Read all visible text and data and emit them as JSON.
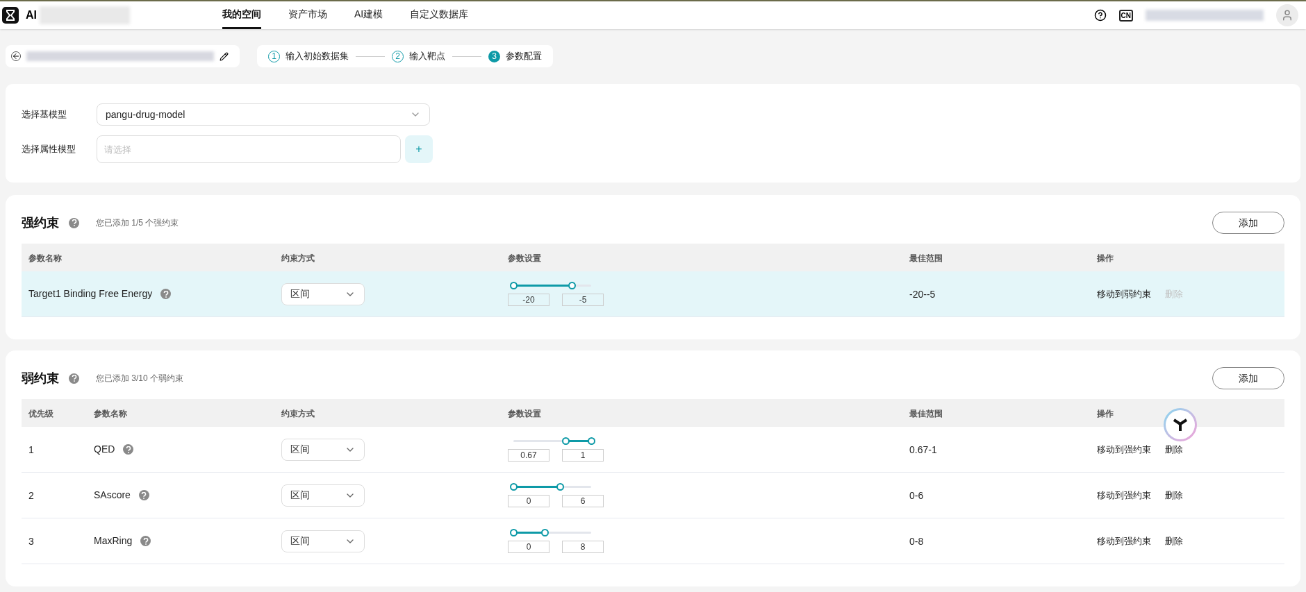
{
  "header": {
    "logo_text": "AI",
    "nav": [
      {
        "label": "我的空间",
        "selected": true
      },
      {
        "label": "资产市场",
        "selected": false
      },
      {
        "label": "AI建模",
        "selected": false
      },
      {
        "label": "自定义数据库",
        "selected": false
      }
    ],
    "lang": "CN"
  },
  "steps": [
    {
      "number": "1",
      "label": "输入初始数据集",
      "selected": false
    },
    {
      "number": "2",
      "label": "输入靶点",
      "selected": false
    },
    {
      "number": "3",
      "label": "参数配置",
      "selected": true
    }
  ],
  "model_form": {
    "base_model": {
      "label": "选择基模型",
      "value": "pangu-drug-model"
    },
    "property_model": {
      "label": "选择属性模型",
      "placeholder": "请选择",
      "add": "+"
    }
  },
  "strong": {
    "title": "强约束",
    "note": "您已添加 1/5 个强约束",
    "add": "添加",
    "columns": [
      "参数名称",
      "约束方式",
      "参数设置",
      "最佳范围",
      "操作"
    ],
    "rows": [
      {
        "name": "Target1 Binding Free Energy",
        "method": "区间",
        "thumbs": [
          {
            "level": 0
          },
          {
            "level": 0.75
          }
        ],
        "low": "-20",
        "high": "-5",
        "range": "-20--5",
        "move": "移动到弱约束",
        "delete": "删除",
        "delete_disabled": true,
        "selected": true
      }
    ]
  },
  "weak": {
    "title": "弱约束",
    "note": "您已添加 3/10 个弱约束",
    "add": "添加",
    "columns": [
      "优先级",
      "参数名称",
      "约束方式",
      "参数设置",
      "最佳范围",
      "操作"
    ],
    "rows": [
      {
        "priority": "1",
        "name": "QED",
        "method": "区间",
        "thumbs": [
          {
            "level": 0.67
          },
          {
            "level": 1
          }
        ],
        "low": "0.67",
        "high": "1",
        "range": "0.67-1",
        "move": "移动到强约束",
        "delete": "删除",
        "delete_disabled": false,
        "selected": false
      },
      {
        "priority": "2",
        "name": "SAscore",
        "method": "区间",
        "thumbs": [
          {
            "level": 0
          },
          {
            "level": 0.6
          }
        ],
        "low": "0",
        "high": "6",
        "range": "0-6",
        "move": "移动到强约束",
        "delete": "删除",
        "delete_disabled": false,
        "selected": false
      },
      {
        "priority": "3",
        "name": "MaxRing",
        "method": "区间",
        "thumbs": [
          {
            "level": 0
          },
          {
            "level": 0.4
          }
        ],
        "low": "0",
        "high": "8",
        "range": "0-8",
        "move": "移动到强约束",
        "delete": "删除",
        "delete_disabled": false,
        "selected": false
      }
    ]
  }
}
